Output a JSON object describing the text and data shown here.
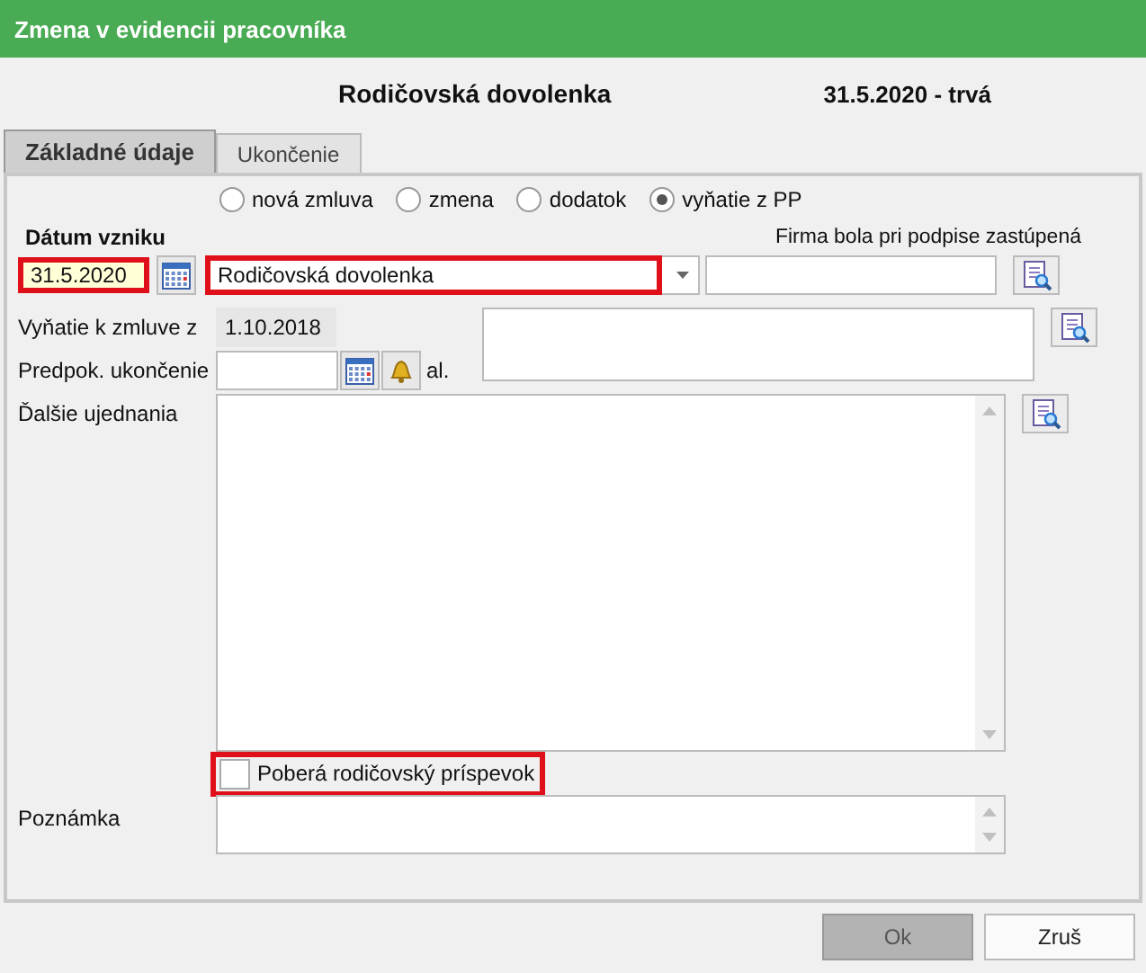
{
  "window": {
    "title": "Zmena v evidencii pracovníka"
  },
  "header": {
    "title": "Rodičovská dovolenka",
    "period": "31.5.2020 - trvá"
  },
  "tabs": [
    {
      "label": "Základné údaje",
      "selected": true
    },
    {
      "label": "Ukončenie",
      "selected": false
    }
  ],
  "contract_types": [
    {
      "label": "nová zmluva",
      "selected": false
    },
    {
      "label": "zmena",
      "selected": false
    },
    {
      "label": "dodatok",
      "selected": false
    },
    {
      "label": "vyňatie z PP",
      "selected": true
    }
  ],
  "start_date": {
    "label": "Dátum vzniku",
    "value": "31.5.2020",
    "highlighted": true
  },
  "type": {
    "value": "Rodičovská dovolenka",
    "highlighted": true
  },
  "represented": {
    "label": "Firma bola pri podpise zastúpená"
  },
  "exemption": {
    "label": "Vyňatie k zmluve z",
    "value": "1.10.2018"
  },
  "expected_end": {
    "label": "Predpok. ukončenie",
    "suffix": "al."
  },
  "other_terms": {
    "label": "Ďalšie ujednania"
  },
  "allowance": {
    "label": "Poberá rodičovský príspevok",
    "checked": false,
    "highlighted": true
  },
  "note": {
    "label": "Poznámka"
  },
  "buttons": [
    {
      "label": "Ok",
      "disabled": true
    },
    {
      "label": "Zruš",
      "disabled": false
    }
  ]
}
